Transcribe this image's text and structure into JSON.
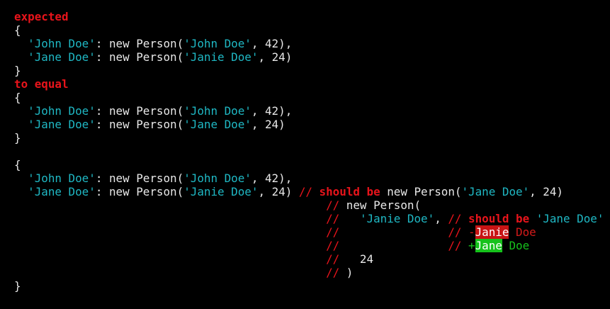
{
  "lines": [
    [
      {
        "t": "expected",
        "c": "red bold"
      }
    ],
    [
      {
        "t": "{",
        "c": "white"
      }
    ],
    [
      {
        "t": "  ",
        "c": "white"
      },
      {
        "t": "'John Doe'",
        "c": "cyan"
      },
      {
        "t": ": new Person(",
        "c": "white"
      },
      {
        "t": "'John Doe'",
        "c": "cyan"
      },
      {
        "t": ", 42),",
        "c": "white"
      }
    ],
    [
      {
        "t": "  ",
        "c": "white"
      },
      {
        "t": "'Jane Doe'",
        "c": "cyan"
      },
      {
        "t": ": new Person(",
        "c": "white"
      },
      {
        "t": "'Janie Doe'",
        "c": "cyan"
      },
      {
        "t": ", 24)",
        "c": "white"
      }
    ],
    [
      {
        "t": "}",
        "c": "white"
      }
    ],
    [
      {
        "t": "to equal",
        "c": "red bold"
      }
    ],
    [
      {
        "t": "{",
        "c": "white"
      }
    ],
    [
      {
        "t": "  ",
        "c": "white"
      },
      {
        "t": "'John Doe'",
        "c": "cyan"
      },
      {
        "t": ": new Person(",
        "c": "white"
      },
      {
        "t": "'John Doe'",
        "c": "cyan"
      },
      {
        "t": ", 42),",
        "c": "white"
      }
    ],
    [
      {
        "t": "  ",
        "c": "white"
      },
      {
        "t": "'Jane Doe'",
        "c": "cyan"
      },
      {
        "t": ": new Person(",
        "c": "white"
      },
      {
        "t": "'Jane Doe'",
        "c": "cyan"
      },
      {
        "t": ", 24)",
        "c": "white"
      }
    ],
    [
      {
        "t": "}",
        "c": "white"
      }
    ],
    [],
    [
      {
        "t": "{",
        "c": "white"
      }
    ],
    [
      {
        "t": "  ",
        "c": "white"
      },
      {
        "t": "'John Doe'",
        "c": "cyan"
      },
      {
        "t": ": new Person(",
        "c": "white"
      },
      {
        "t": "'John Doe'",
        "c": "cyan"
      },
      {
        "t": ", 42),",
        "c": "white"
      }
    ],
    [
      {
        "t": "  ",
        "c": "white"
      },
      {
        "t": "'Jane Doe'",
        "c": "cyan"
      },
      {
        "t": ": new Person(",
        "c": "white"
      },
      {
        "t": "'Janie Doe'",
        "c": "cyan"
      },
      {
        "t": ", 24) ",
        "c": "white"
      },
      {
        "t": "// ",
        "c": "red"
      },
      {
        "t": "should be",
        "c": "red bold"
      },
      {
        "t": " new Person(",
        "c": "white"
      },
      {
        "t": "'Jane Doe'",
        "c": "cyan"
      },
      {
        "t": ", 24)",
        "c": "white"
      }
    ],
    [
      {
        "t": "                                              ",
        "c": "white"
      },
      {
        "t": "//",
        "c": "red"
      },
      {
        "t": " new Person(",
        "c": "white"
      }
    ],
    [
      {
        "t": "                                              ",
        "c": "white"
      },
      {
        "t": "//",
        "c": "red"
      },
      {
        "t": "   ",
        "c": "white"
      },
      {
        "t": "'Janie Doe'",
        "c": "cyan"
      },
      {
        "t": ", ",
        "c": "white"
      },
      {
        "t": "// ",
        "c": "red"
      },
      {
        "t": "should be",
        "c": "red bold"
      },
      {
        "t": " ",
        "c": "white"
      },
      {
        "t": "'Jane Doe'",
        "c": "cyan"
      }
    ],
    [
      {
        "t": "                                              ",
        "c": "white"
      },
      {
        "t": "//",
        "c": "red"
      },
      {
        "t": "                ",
        "c": "white"
      },
      {
        "t": "// ",
        "c": "red"
      },
      {
        "t": "-",
        "c": "del"
      },
      {
        "t": "Janie",
        "c": "delhl"
      },
      {
        "t": " Doe",
        "c": "del"
      }
    ],
    [
      {
        "t": "                                              ",
        "c": "white"
      },
      {
        "t": "//",
        "c": "red"
      },
      {
        "t": "                ",
        "c": "white"
      },
      {
        "t": "// ",
        "c": "red"
      },
      {
        "t": "+",
        "c": "add"
      },
      {
        "t": "Jane",
        "c": "addhl"
      },
      {
        "t": " Doe",
        "c": "add"
      }
    ],
    [
      {
        "t": "                                              ",
        "c": "white"
      },
      {
        "t": "//",
        "c": "red"
      },
      {
        "t": "   24",
        "c": "white"
      }
    ],
    [
      {
        "t": "                                              ",
        "c": "white"
      },
      {
        "t": "// ",
        "c": "red"
      },
      {
        "t": ")",
        "c": "white"
      }
    ],
    [
      {
        "t": "}",
        "c": "white"
      }
    ]
  ],
  "colors": {
    "background": "#000000",
    "text": "#e8e8e8",
    "error_red": "#e8141b",
    "string_cyan": "#1fb8c4",
    "diff_removed": "#c81414",
    "diff_added": "#16c21c"
  }
}
